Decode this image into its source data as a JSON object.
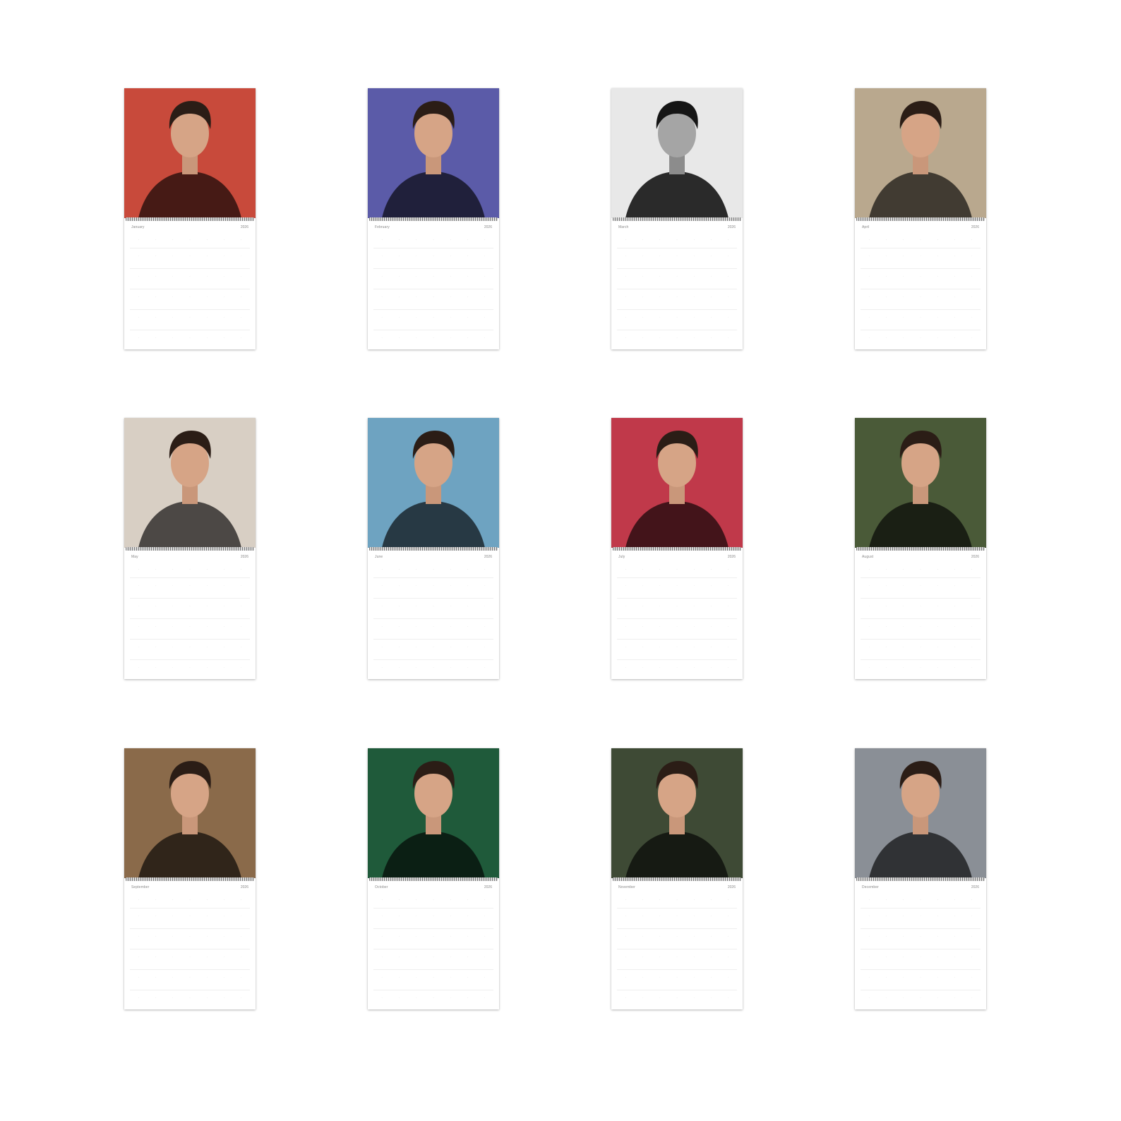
{
  "calendar": {
    "months": [
      {
        "name": "January",
        "year": "2026",
        "photo_bg": "#c84a3b",
        "mono": false
      },
      {
        "name": "February",
        "year": "2026",
        "photo_bg": "#5b5ba8",
        "mono": false
      },
      {
        "name": "March",
        "year": "2026",
        "photo_bg": "#e8e8e8",
        "mono": true
      },
      {
        "name": "April",
        "year": "2026",
        "photo_bg": "#b9a88e",
        "mono": false
      },
      {
        "name": "May",
        "year": "2026",
        "photo_bg": "#d8cfc4",
        "mono": false
      },
      {
        "name": "June",
        "year": "2026",
        "photo_bg": "#6ea3c1",
        "mono": false
      },
      {
        "name": "July",
        "year": "2026",
        "photo_bg": "#c0394a",
        "mono": false
      },
      {
        "name": "August",
        "year": "2026",
        "photo_bg": "#4a5a38",
        "mono": false
      },
      {
        "name": "September",
        "year": "2026",
        "photo_bg": "#8a6a4a",
        "mono": false
      },
      {
        "name": "October",
        "year": "2026",
        "photo_bg": "#1f5a3a",
        "mono": false
      },
      {
        "name": "November",
        "year": "2026",
        "photo_bg": "#3e4a35",
        "mono": false
      },
      {
        "name": "December",
        "year": "2026",
        "photo_bg": "#8a8f96",
        "mono": false
      }
    ]
  }
}
